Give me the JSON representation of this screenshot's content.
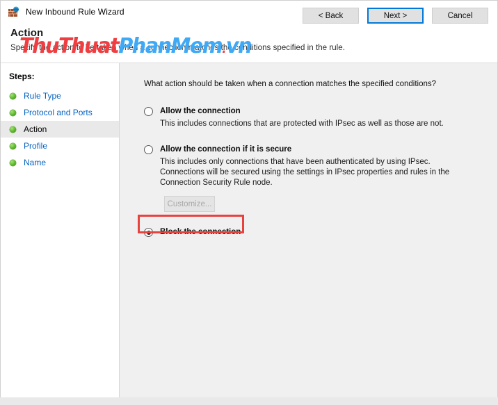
{
  "window": {
    "title": "New Inbound Rule Wizard",
    "icon": "firewall-globe-icon",
    "close_label": "✕"
  },
  "header": {
    "title": "Action",
    "subtitle": "Specify the action to be taken when a connection matches the conditions specified in the rule."
  },
  "watermark": {
    "part1": "ThuThuat",
    "part2": "PhanMem",
    "dot": ".",
    "part3": "vn",
    "color_red": "#ef3e42",
    "color_blue": "#3fa9f5"
  },
  "sidebar": {
    "heading": "Steps:",
    "items": [
      {
        "label": "Rule Type",
        "current": false
      },
      {
        "label": "Protocol and Ports",
        "current": false
      },
      {
        "label": "Action",
        "current": true
      },
      {
        "label": "Profile",
        "current": false
      },
      {
        "label": "Name",
        "current": false
      }
    ]
  },
  "main": {
    "question": "What action should be taken when a connection matches the specified conditions?",
    "options": [
      {
        "title": "Allow the connection",
        "description": "This includes connections that are protected with IPsec as well as those are not.",
        "selected": false
      },
      {
        "title": "Allow the connection if it is secure",
        "description": "This includes only connections that have been authenticated by using IPsec.  Connections will be secured using the settings in IPsec properties and rules in the Connection Security Rule node.",
        "selected": false,
        "button": {
          "label": "Customize...",
          "disabled": true
        }
      },
      {
        "title": "Block the connection",
        "description": "",
        "selected": true,
        "highlighted": true
      }
    ]
  },
  "footer": {
    "buttons": [
      {
        "label": "< Back",
        "default": false
      },
      {
        "label": "Next >",
        "default": true
      },
      {
        "label": "Cancel",
        "default": false
      }
    ]
  },
  "background": {
    "sliver_text": "",
    "sliver_text2": ""
  }
}
